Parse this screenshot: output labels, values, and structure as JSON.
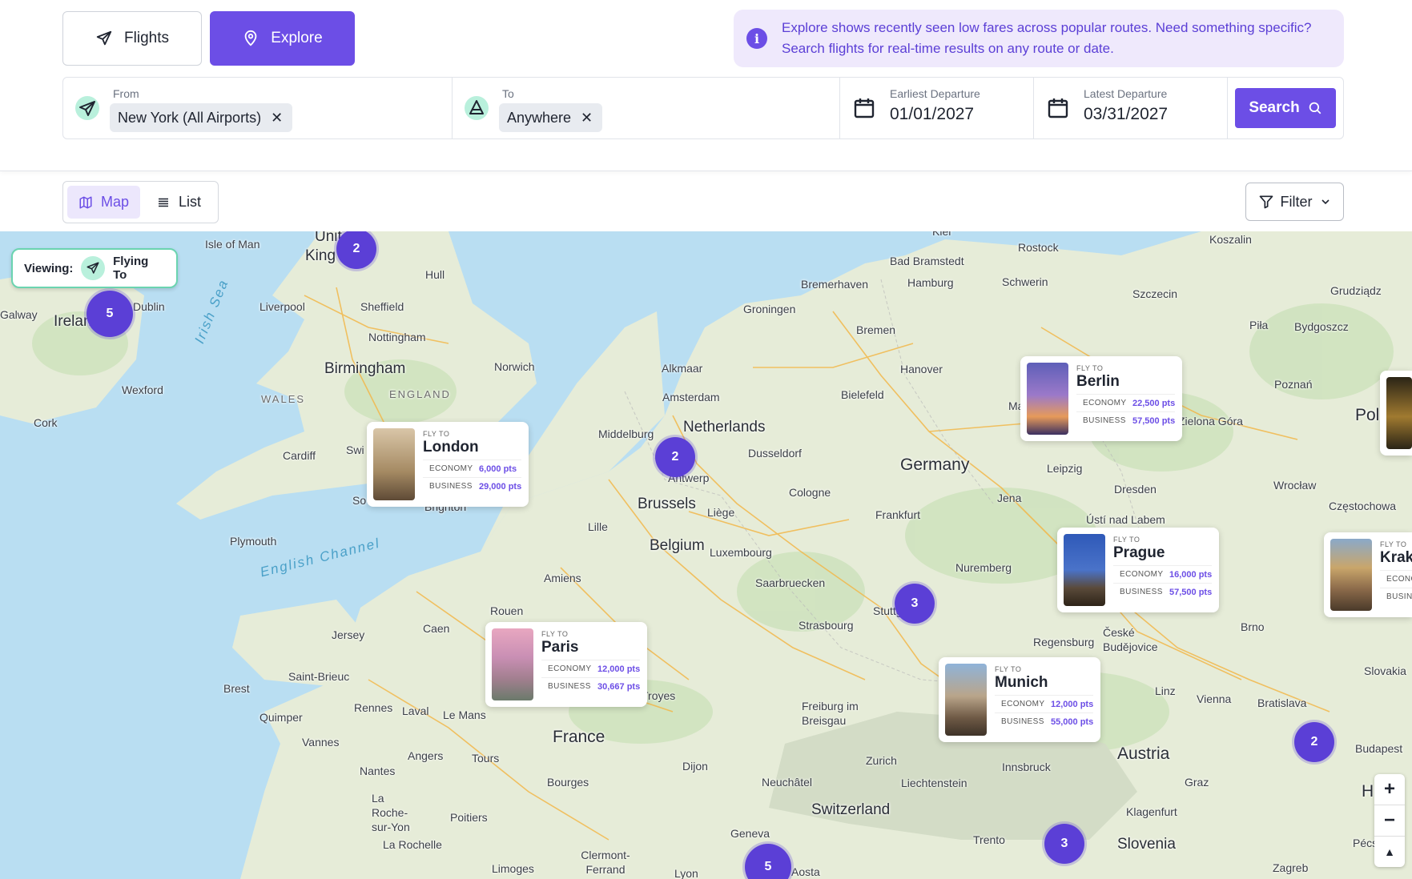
{
  "header": {
    "tabs": {
      "flights": "Flights",
      "explore": "Explore"
    },
    "info": "Explore shows recently seen low fares across popular routes. Need something specific? Search flights for real-time results on any route or date.",
    "from": {
      "label": "From",
      "value": "New York (All Airports)"
    },
    "to": {
      "label": "To",
      "value": "Anywhere"
    },
    "earliest": {
      "label": "Earliest Departure",
      "value": "01/01/2027"
    },
    "latest": {
      "label": "Latest Departure",
      "value": "03/31/2027"
    },
    "search_label": "Search"
  },
  "view": {
    "map": "Map",
    "list": "List",
    "filter": "Filter"
  },
  "map": {
    "viewing_label": "Viewing:",
    "viewing_value": "Flying To",
    "clusters": [
      "2",
      "5",
      "2",
      "3",
      "2",
      "5",
      "3"
    ],
    "cards": [
      {
        "fly": "FLY TO",
        "city": "London",
        "economy_label": "ECONOMY",
        "economy": "6,000 pts",
        "business_label": "BUSINESS",
        "business": "29,000 pts"
      },
      {
        "fly": "FLY TO",
        "city": "Berlin",
        "economy_label": "ECONOMY",
        "economy": "22,500 pts",
        "business_label": "BUSINESS",
        "business": "57,500 pts"
      },
      {
        "fly": "FLY TO",
        "city": "Prague",
        "economy_label": "ECONOMY",
        "economy": "16,000 pts",
        "business_label": "BUSINESS",
        "business": "57,500 pts"
      },
      {
        "fly": "FLY TO",
        "city": "Paris",
        "economy_label": "ECONOMY",
        "economy": "12,000 pts",
        "business_label": "BUSINESS",
        "business": "30,667 pts"
      },
      {
        "fly": "FLY TO",
        "city": "Munich",
        "economy_label": "ECONOMY",
        "economy": "12,000 pts",
        "business_label": "BUSINESS",
        "business": "55,000 pts"
      },
      {
        "fly": "FLY TO",
        "city": "Krako",
        "economy_label": "ECONO",
        "business_label": "BUSINE"
      }
    ],
    "places": [
      "Isle of Man",
      "Unit",
      "King",
      "Hull",
      "Ireland",
      "Dublin",
      "Galway",
      "Liverpool",
      "Sheffield",
      "Nottingham",
      "Birmingham",
      "Norwich",
      "ENGLAND",
      "WALES",
      "Wexford",
      "Cork",
      "Cardiff",
      "Swi",
      "So",
      "Brighton",
      "Plymouth",
      "English Channel",
      "Irish Sea",
      "Jersey",
      "Caen",
      "Rouen",
      "Amiens",
      "Lille",
      "Brussels",
      "Belgium",
      "Antwerp",
      "Middelburg",
      "Amsterdam",
      "Alkmaar",
      "Netherlands",
      "Groningen",
      "Dusseldorf",
      "Cologne",
      "Liège",
      "Luxembourg",
      "Saarbruecken",
      "Strasbourg",
      "Frankfurt",
      "Stuttgart",
      "Nuremberg",
      "Germany",
      "Hanover",
      "Bielefeld",
      "Bremen",
      "Bremerhaven",
      "Hamburg",
      "Bad Bramstedt",
      "Schwerin",
      "Rostock",
      "Kiel",
      "Szczecin",
      "Koszalin",
      "Grudziądz",
      "Bydgoszcz",
      "Piła",
      "Poznań",
      "Magdeb",
      "Leipzig",
      "Jena",
      "Dresden",
      "Ústí nad Labem",
      "Zielona Góra",
      "Wrocław",
      "Częstochowa",
      "Pol",
      "Regensburg",
      "České Budějovice",
      "Brno",
      "Linz",
      "Vienna",
      "Bratislava",
      "Slovakia",
      "Budapest",
      "Austria",
      "Innsbruck",
      "Graz",
      "Klagenfurt",
      "Slovenia",
      "Pécs",
      "Zagreb",
      "Trento",
      "Liechtenstein",
      "Zurich",
      "Switzerland",
      "Neuchâtel",
      "Freiburg im Breisgau",
      "Geneva",
      "Aosta",
      "Lyon",
      "Dijon",
      "Clermont-Ferrand",
      "Limoges",
      "Bourges",
      "Tours",
      "Poitiers",
      "La Rochelle",
      "La Roche-sur-Yon",
      "Nantes",
      "Angers",
      "Le Mans",
      "Laval",
      "Rennes",
      "Vannes",
      "Quimper",
      "Brest",
      "Saint-Brieuc",
      "France",
      "Troyes",
      "H"
    ]
  }
}
